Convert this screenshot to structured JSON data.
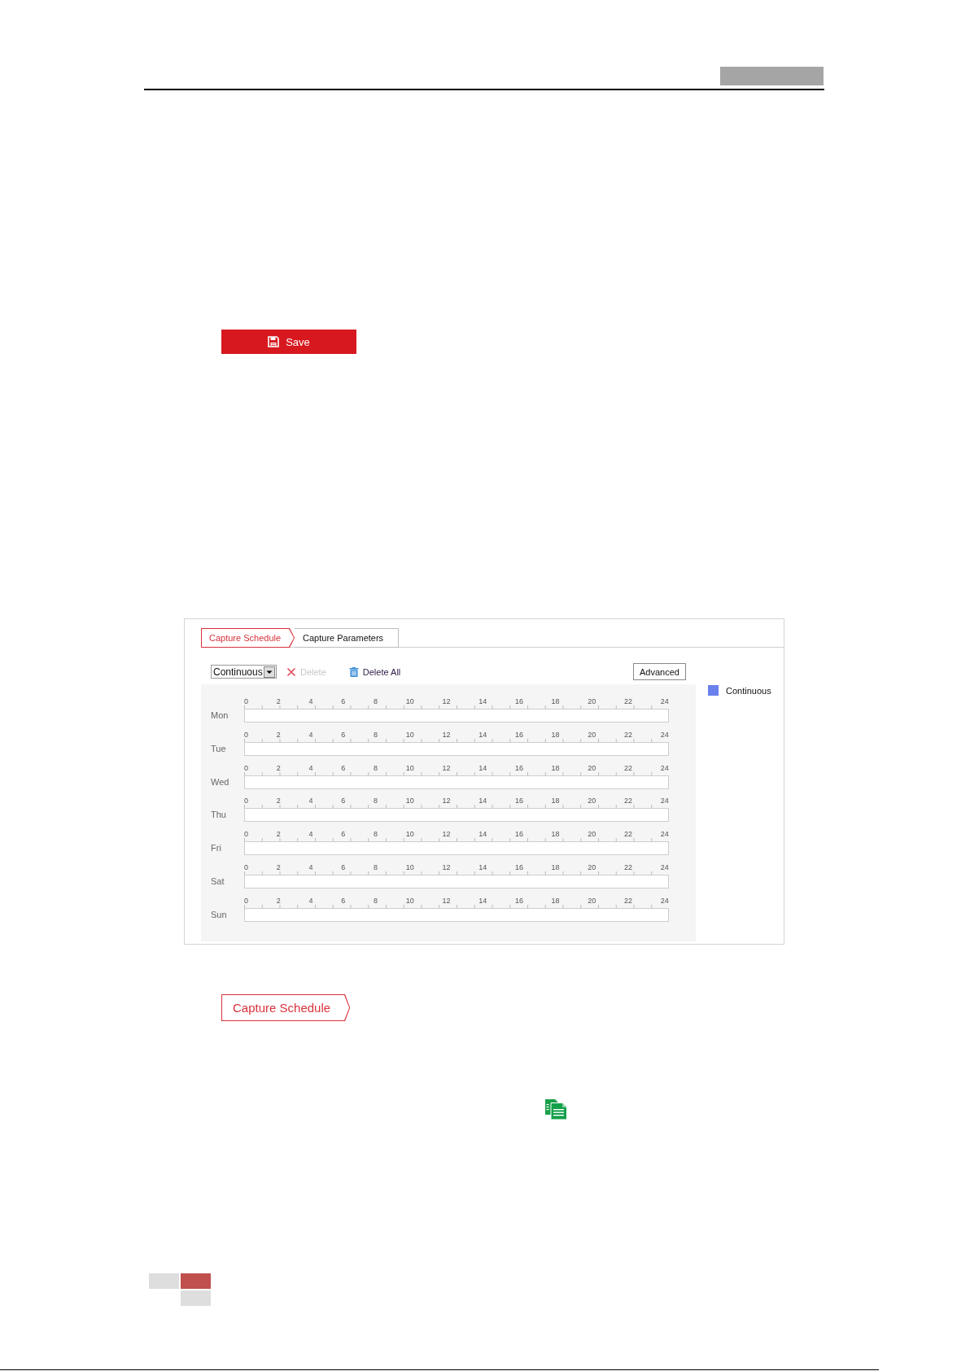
{
  "save_button": {
    "label": "Save"
  },
  "schedule_panel": {
    "tabs": [
      {
        "label": "Capture Schedule",
        "selected": true
      },
      {
        "label": "Capture Parameters",
        "selected": false
      }
    ],
    "mode_select": {
      "value": "Continuous"
    },
    "actions": [
      {
        "kind": "delete",
        "label": "Delete",
        "disabled": true
      },
      {
        "kind": "delete_all",
        "label": "Delete All",
        "disabled": false
      }
    ],
    "advanced_button": {
      "label": "Advanced"
    },
    "days": [
      {
        "label": "Mon",
        "ticks": [
          "0",
          "2",
          "4",
          "6",
          "8",
          "10",
          "12",
          "14",
          "16",
          "18",
          "20",
          "22",
          "24"
        ]
      },
      {
        "label": "Tue",
        "ticks": [
          "0",
          "2",
          "4",
          "6",
          "8",
          "10",
          "12",
          "14",
          "16",
          "18",
          "20",
          "22",
          "24"
        ]
      },
      {
        "label": "Wed",
        "ticks": [
          "0",
          "2",
          "4",
          "6",
          "8",
          "10",
          "12",
          "14",
          "16",
          "18",
          "20",
          "22",
          "24"
        ]
      },
      {
        "label": "Thu",
        "ticks": [
          "0",
          "2",
          "4",
          "6",
          "8",
          "10",
          "12",
          "14",
          "16",
          "18",
          "20",
          "22",
          "24"
        ]
      },
      {
        "label": "Fri",
        "ticks": [
          "0",
          "2",
          "4",
          "6",
          "8",
          "10",
          "12",
          "14",
          "16",
          "18",
          "20",
          "22",
          "24"
        ]
      },
      {
        "label": "Sat",
        "ticks": [
          "0",
          "2",
          "4",
          "6",
          "8",
          "10",
          "12",
          "14",
          "16",
          "18",
          "20",
          "22",
          "24"
        ]
      },
      {
        "label": "Sun",
        "ticks": [
          "0",
          "2",
          "4",
          "6",
          "8",
          "10",
          "12",
          "14",
          "16",
          "18",
          "20",
          "22",
          "24"
        ]
      }
    ],
    "legend": [
      {
        "label": "Continuous",
        "color": "#6a80ec"
      }
    ]
  },
  "tab_example": {
    "label": "Capture Schedule",
    "selected": true
  }
}
